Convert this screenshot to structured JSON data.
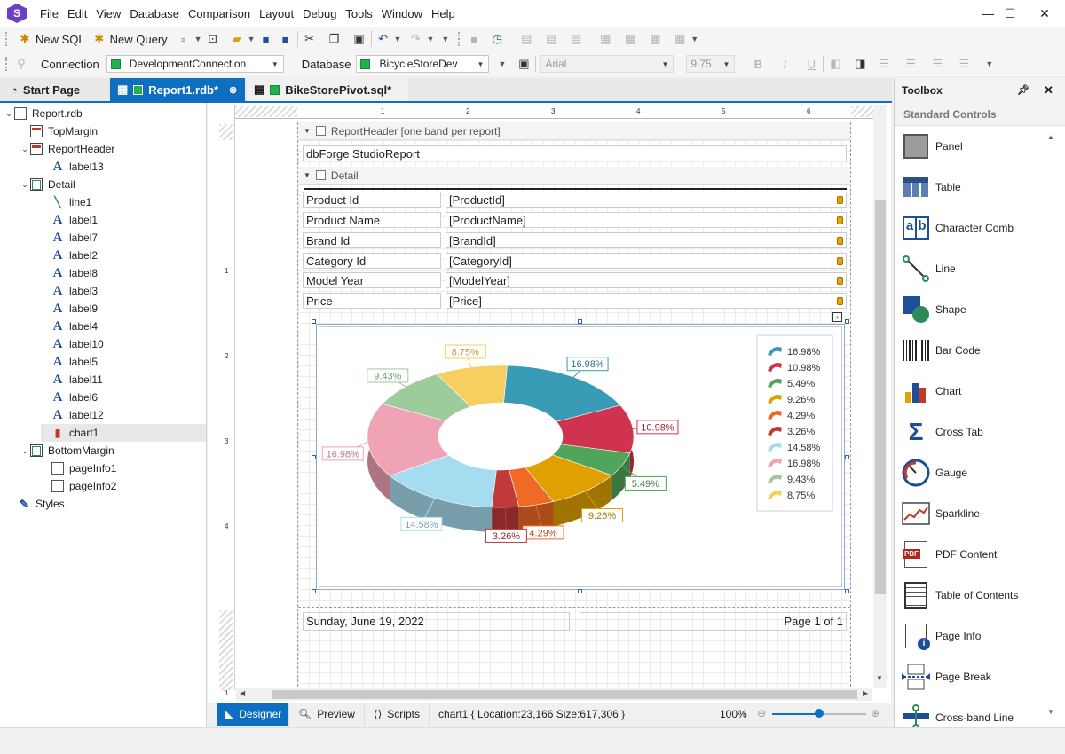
{
  "menu": [
    "File",
    "Edit",
    "View",
    "Database",
    "Comparison",
    "Layout",
    "Debug",
    "Tools",
    "Window",
    "Help"
  ],
  "app_logo": "S",
  "window_controls": {
    "minimize": "—",
    "maximize": "☐",
    "close": "✕"
  },
  "toolbar1": {
    "new_sql": "New SQL",
    "new_query": "New Query"
  },
  "toolbar2": {
    "connection_label": "Connection",
    "connection_value": "DevelopmentConnection",
    "database_label": "Database",
    "database_value": "BicycleStoreDev",
    "font_value": "Arial",
    "font_size_value": "9.75",
    "bold": "B",
    "italic": "I",
    "underline": "U"
  },
  "tabs": [
    {
      "label": "Start Page"
    },
    {
      "label": "Report1.rdb*"
    },
    {
      "label": "BikeStorePivot.sql*"
    }
  ],
  "tree": [
    {
      "label": "Report.rdb",
      "icon": "report-icon"
    },
    {
      "label": "TopMargin",
      "icon": "band-icon"
    },
    {
      "label": "ReportHeader",
      "icon": "band-icon"
    },
    {
      "label": "label13",
      "icon": "label-icon"
    },
    {
      "label": "Detail",
      "icon": "band-icon"
    },
    {
      "label": "line1",
      "icon": "line-icon"
    },
    {
      "label": "label1",
      "icon": "label-icon"
    },
    {
      "label": "label7",
      "icon": "bound-label-icon"
    },
    {
      "label": "label2",
      "icon": "label-icon"
    },
    {
      "label": "label8",
      "icon": "bound-label-icon"
    },
    {
      "label": "label3",
      "icon": "label-icon"
    },
    {
      "label": "label9",
      "icon": "bound-label-icon"
    },
    {
      "label": "label4",
      "icon": "label-icon"
    },
    {
      "label": "label10",
      "icon": "bound-label-icon"
    },
    {
      "label": "label5",
      "icon": "label-icon"
    },
    {
      "label": "label11",
      "icon": "bound-label-icon"
    },
    {
      "label": "label6",
      "icon": "label-icon"
    },
    {
      "label": "label12",
      "icon": "bound-label-icon"
    },
    {
      "label": "chart1",
      "icon": "chart-icon"
    },
    {
      "label": "BottomMargin",
      "icon": "band-icon"
    },
    {
      "label": "pageInfo1",
      "icon": "page-info-icon"
    },
    {
      "label": "pageInfo2",
      "icon": "page-info-icon"
    },
    {
      "label": "Styles",
      "icon": "styles-icon"
    }
  ],
  "ruler": {
    "top": [
      "1",
      "2",
      "3",
      "4",
      "5",
      "6"
    ],
    "left": [
      "1",
      "2",
      "3",
      "4",
      "1"
    ]
  },
  "report": {
    "report_header_band": "ReportHeader [one band per report]",
    "title_text": "dbForge StudioReport",
    "detail_band": "Detail",
    "rows": [
      {
        "label": "Product Id",
        "field": "[ProductId]"
      },
      {
        "label": "Product Name",
        "field": "[ProductName]"
      },
      {
        "label": "Brand Id",
        "field": "[BrandId]"
      },
      {
        "label": "Category Id",
        "field": "[CategoryId]"
      },
      {
        "label": "Model Year",
        "field": "[ModelYear]"
      },
      {
        "label": "Price",
        "field": "[Price]"
      }
    ],
    "footer_date": "Sunday, June 19, 2022",
    "footer_page": "Page 1 of 1"
  },
  "chart_data": {
    "type": "pie",
    "style": "3d-doughnut",
    "values": [
      16.98,
      10.98,
      5.49,
      9.26,
      4.29,
      3.26,
      14.58,
      16.98,
      9.43,
      8.75
    ],
    "labels": [
      "16.98%",
      "10.98%",
      "5.49%",
      "9.26%",
      "4.29%",
      "3.26%",
      "14.58%",
      "16.98%",
      "9.43%",
      "8.75%"
    ],
    "colors": [
      "#3a9bb6",
      "#d0334e",
      "#4fa65a",
      "#e0a000",
      "#f06a25",
      "#c0393b",
      "#a6dcef",
      "#f0a3b5",
      "#9ccc9c",
      "#f6cf60"
    ],
    "legend_position": "right"
  },
  "bottom_tabs": {
    "designer": "Designer",
    "preview": "Preview",
    "scripts": "Scripts"
  },
  "status_text": "chart1 { Location:23,166 Size:617,306 }",
  "zoom": "100%",
  "zoom_level": 0.5,
  "toolbox": {
    "title": "Toolbox",
    "category": "Standard Controls",
    "items": [
      {
        "label": "Panel",
        "icon": "panel-icon"
      },
      {
        "label": "Table",
        "icon": "table-icon"
      },
      {
        "label": "Character Comb",
        "icon": "character-comb-icon"
      },
      {
        "label": "Line",
        "icon": "line-icon"
      },
      {
        "label": "Shape",
        "icon": "shape-icon"
      },
      {
        "label": "Bar Code",
        "icon": "barcode-icon"
      },
      {
        "label": "Chart",
        "icon": "chart-icon"
      },
      {
        "label": "Cross Tab",
        "icon": "cross-tab-icon"
      },
      {
        "label": "Gauge",
        "icon": "gauge-icon"
      },
      {
        "label": "Sparkline",
        "icon": "sparkline-icon"
      },
      {
        "label": "PDF Content",
        "icon": "pdf-icon"
      },
      {
        "label": "Table of Contents",
        "icon": "toc-icon"
      },
      {
        "label": "Page Info",
        "icon": "page-info-icon"
      },
      {
        "label": "Page Break",
        "icon": "page-break-icon"
      },
      {
        "label": "Cross-band Line",
        "icon": "cross-band-line-icon"
      }
    ]
  },
  "pdf_badge": "PDF"
}
